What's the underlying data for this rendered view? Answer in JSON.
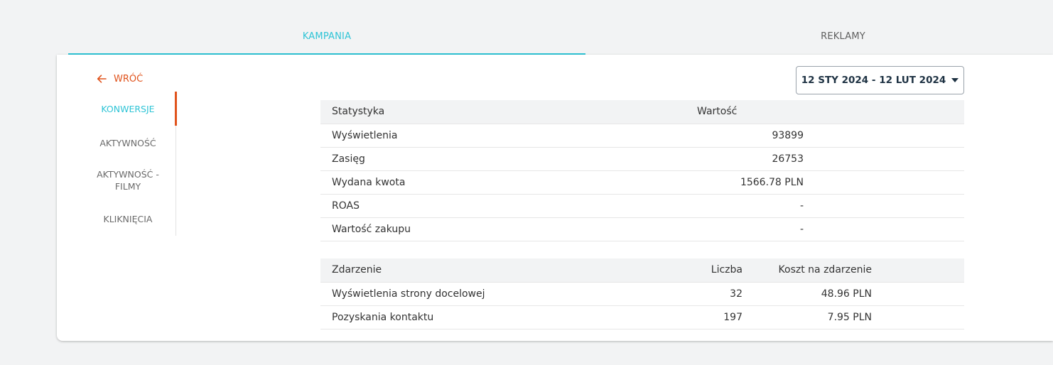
{
  "tabs": [
    {
      "label": "KAMPANIA",
      "active": true
    },
    {
      "label": "REKLAMY",
      "active": false
    }
  ],
  "back": {
    "label": "WRÓĆ"
  },
  "side_nav": [
    {
      "label": "KONWERSJE",
      "active": true
    },
    {
      "label": "AKTYWNOŚĆ",
      "active": false
    },
    {
      "label": "AKTYWNOŚĆ -",
      "label2": "FILMY",
      "active": false
    },
    {
      "label": "KLIKNIĘCIA",
      "active": false
    }
  ],
  "date_range": {
    "label": "12 STY 2024 - 12 LUT 2024"
  },
  "stats_table": {
    "headers": [
      "Statystyka",
      "Wartość"
    ],
    "rows": [
      [
        "Wyświetlenia",
        "93899"
      ],
      [
        "Zasięg",
        "26753"
      ],
      [
        "Wydana kwota",
        "1566.78 PLN"
      ],
      [
        "ROAS",
        "-"
      ],
      [
        "Wartość zakupu",
        "-"
      ]
    ]
  },
  "events_table": {
    "headers": [
      "Zdarzenie",
      "Liczba",
      "Koszt na zdarzenie"
    ],
    "rows": [
      [
        "Wyświetlenia strony docelowej",
        "32",
        "48.96 PLN"
      ],
      [
        "Pozyskania kontaktu",
        "197",
        "7.95 PLN"
      ]
    ]
  },
  "colors": {
    "accent": "#2ec4d6",
    "back": "#e0531c",
    "nav_indicator": "#e0531c"
  }
}
